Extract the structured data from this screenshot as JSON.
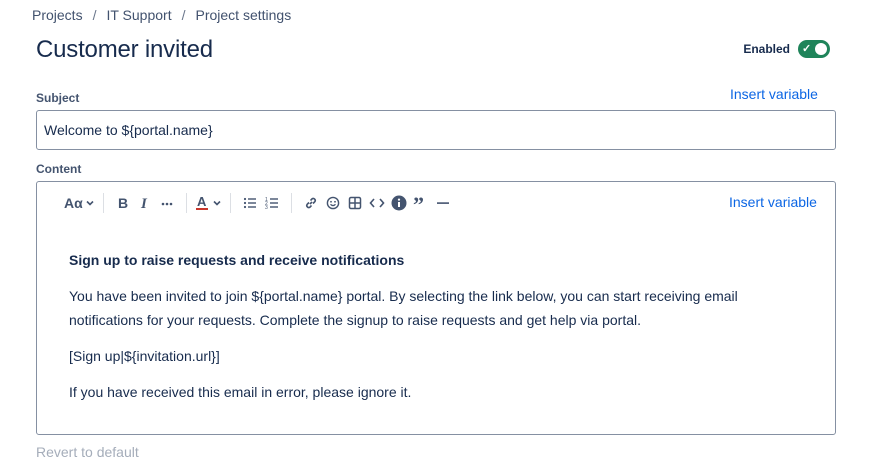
{
  "breadcrumb": {
    "items": [
      "Projects",
      "IT Support",
      "Project settings"
    ],
    "separator": "/"
  },
  "page": {
    "title": "Customer invited"
  },
  "status_toggle": {
    "label": "Enabled",
    "enabled": true,
    "on_color": "#1f845a"
  },
  "subject": {
    "label": "Subject",
    "insert_variable": "Insert variable",
    "value": "Welcome to ${portal.name}"
  },
  "content": {
    "label": "Content",
    "insert_variable": "Insert variable",
    "toolbar": {
      "text_style": "Aα",
      "icons": [
        "text-style-icon",
        "chevron-down-icon",
        "bold-icon",
        "italic-icon",
        "more-icon",
        "text-color-icon",
        "chevron-down-icon",
        "bullet-list-icon",
        "numbered-list-icon",
        "link-icon",
        "emoji-icon",
        "table-icon",
        "code-icon",
        "info-panel-icon",
        "quote-icon",
        "divider-icon"
      ]
    },
    "heading": "Sign up to raise requests and receive notifications",
    "paragraph_1": "You have been invited to join ${portal.name} portal. By selecting the link below, you can start receiving email notifications for your requests. Complete the signup to raise requests and get help via portal.",
    "paragraph_2": "[Sign up|${invitation.url}]",
    "paragraph_3": "If you have received this email in error, please ignore it."
  },
  "footer": {
    "revert_label": "Revert to default"
  },
  "colors": {
    "link": "#0c66e4",
    "text": "#172b4d",
    "muted": "#a5adba"
  }
}
